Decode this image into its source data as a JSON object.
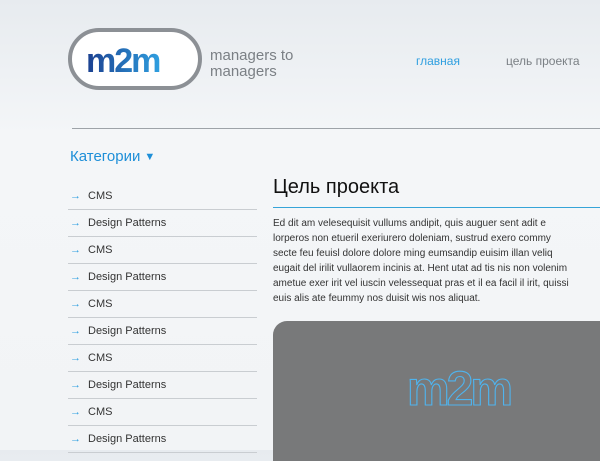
{
  "brand": {
    "logo_text": "m2m",
    "tagline_line1": "managers to",
    "tagline_line2": "managers"
  },
  "nav": {
    "items": [
      {
        "label": "главная",
        "active": true
      },
      {
        "label": "цель проекта",
        "active": false
      }
    ]
  },
  "sidebar": {
    "title": "Категории",
    "toggle_icon": "triangle-down",
    "items": [
      {
        "label": "CMS"
      },
      {
        "label": "Design Patterns"
      },
      {
        "label": "CMS"
      },
      {
        "label": "Design Patterns"
      },
      {
        "label": "CMS"
      },
      {
        "label": "Design Patterns"
      },
      {
        "label": "CMS"
      },
      {
        "label": "Design Patterns"
      },
      {
        "label": "CMS"
      },
      {
        "label": "Design Patterns"
      }
    ]
  },
  "main": {
    "title": "Цель проекта",
    "paragraph_lines": [
      "Ed dit am velesequisit vullums andipit, quis auguer sent adit e",
      "lorperos non etueril exeriurero doleniam, sustrud exero commy",
      "secte feu feuisl dolore dolore ming eumsandip euisim illan veliq",
      "eugait del irilit vullaorem incinis at. Hent utat ad tis nis non volenim",
      "ametue exer irit vel iuscin velessequat pras et il ea facil il irit, quissi",
      "euis alis ate feummy nos duisit wis nos aliquat."
    ],
    "panel_logo_text": "m2m"
  },
  "colors": {
    "accent": "#2f9fe0",
    "logo_dark_blue": "#1b3f8f",
    "logo_light_blue": "#2f9fe0",
    "panel_bg": "#78797a"
  }
}
